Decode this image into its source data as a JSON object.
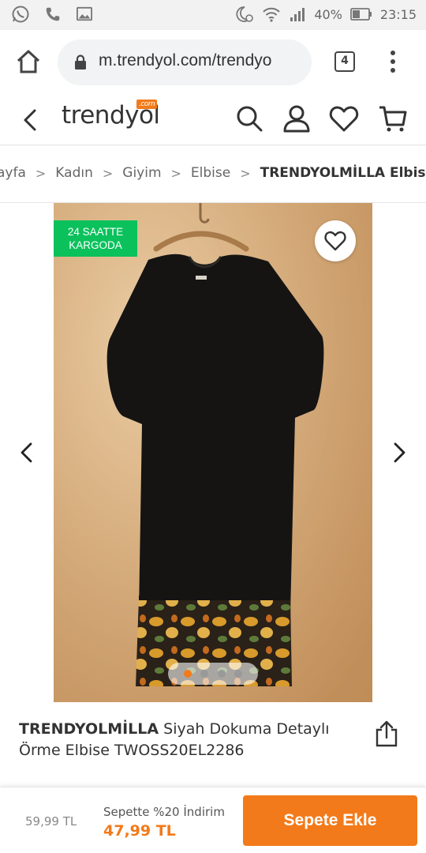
{
  "status_bar": {
    "battery": "40%",
    "time": "23:15",
    "icons": [
      "whatsapp-icon",
      "phone-icon",
      "image-icon",
      "moon-alarm-icon",
      "wifi-icon",
      "signal-icon",
      "battery-icon"
    ]
  },
  "browser": {
    "url": "m.trendyol.com/trendyo",
    "tab_count": "4"
  },
  "header": {
    "logo": "trendyol",
    "logo_badge": ".com"
  },
  "breadcrumb": {
    "items": [
      "ayfa",
      "Kadın",
      "Giyim",
      "Elbise",
      "TRENDYOLMİLLA Elbise"
    ]
  },
  "gallery": {
    "badge_line1": "24 SAATTE",
    "badge_line2": "KARGODA",
    "image_count": 4,
    "active_index": 0
  },
  "product": {
    "brand": "TRENDYOLMİLLA",
    "name": "Siyah Dokuma Detaylı Örme Elbise TWOSS20EL2286"
  },
  "purchase": {
    "old_price": "59,99 TL",
    "discount_label": "Sepette %20 İndirim",
    "new_price": "47,99 TL",
    "add_to_cart": "Sepete Ekle"
  },
  "colors": {
    "accent": "#f27a1a",
    "cargo_badge": "#0bc15c"
  }
}
